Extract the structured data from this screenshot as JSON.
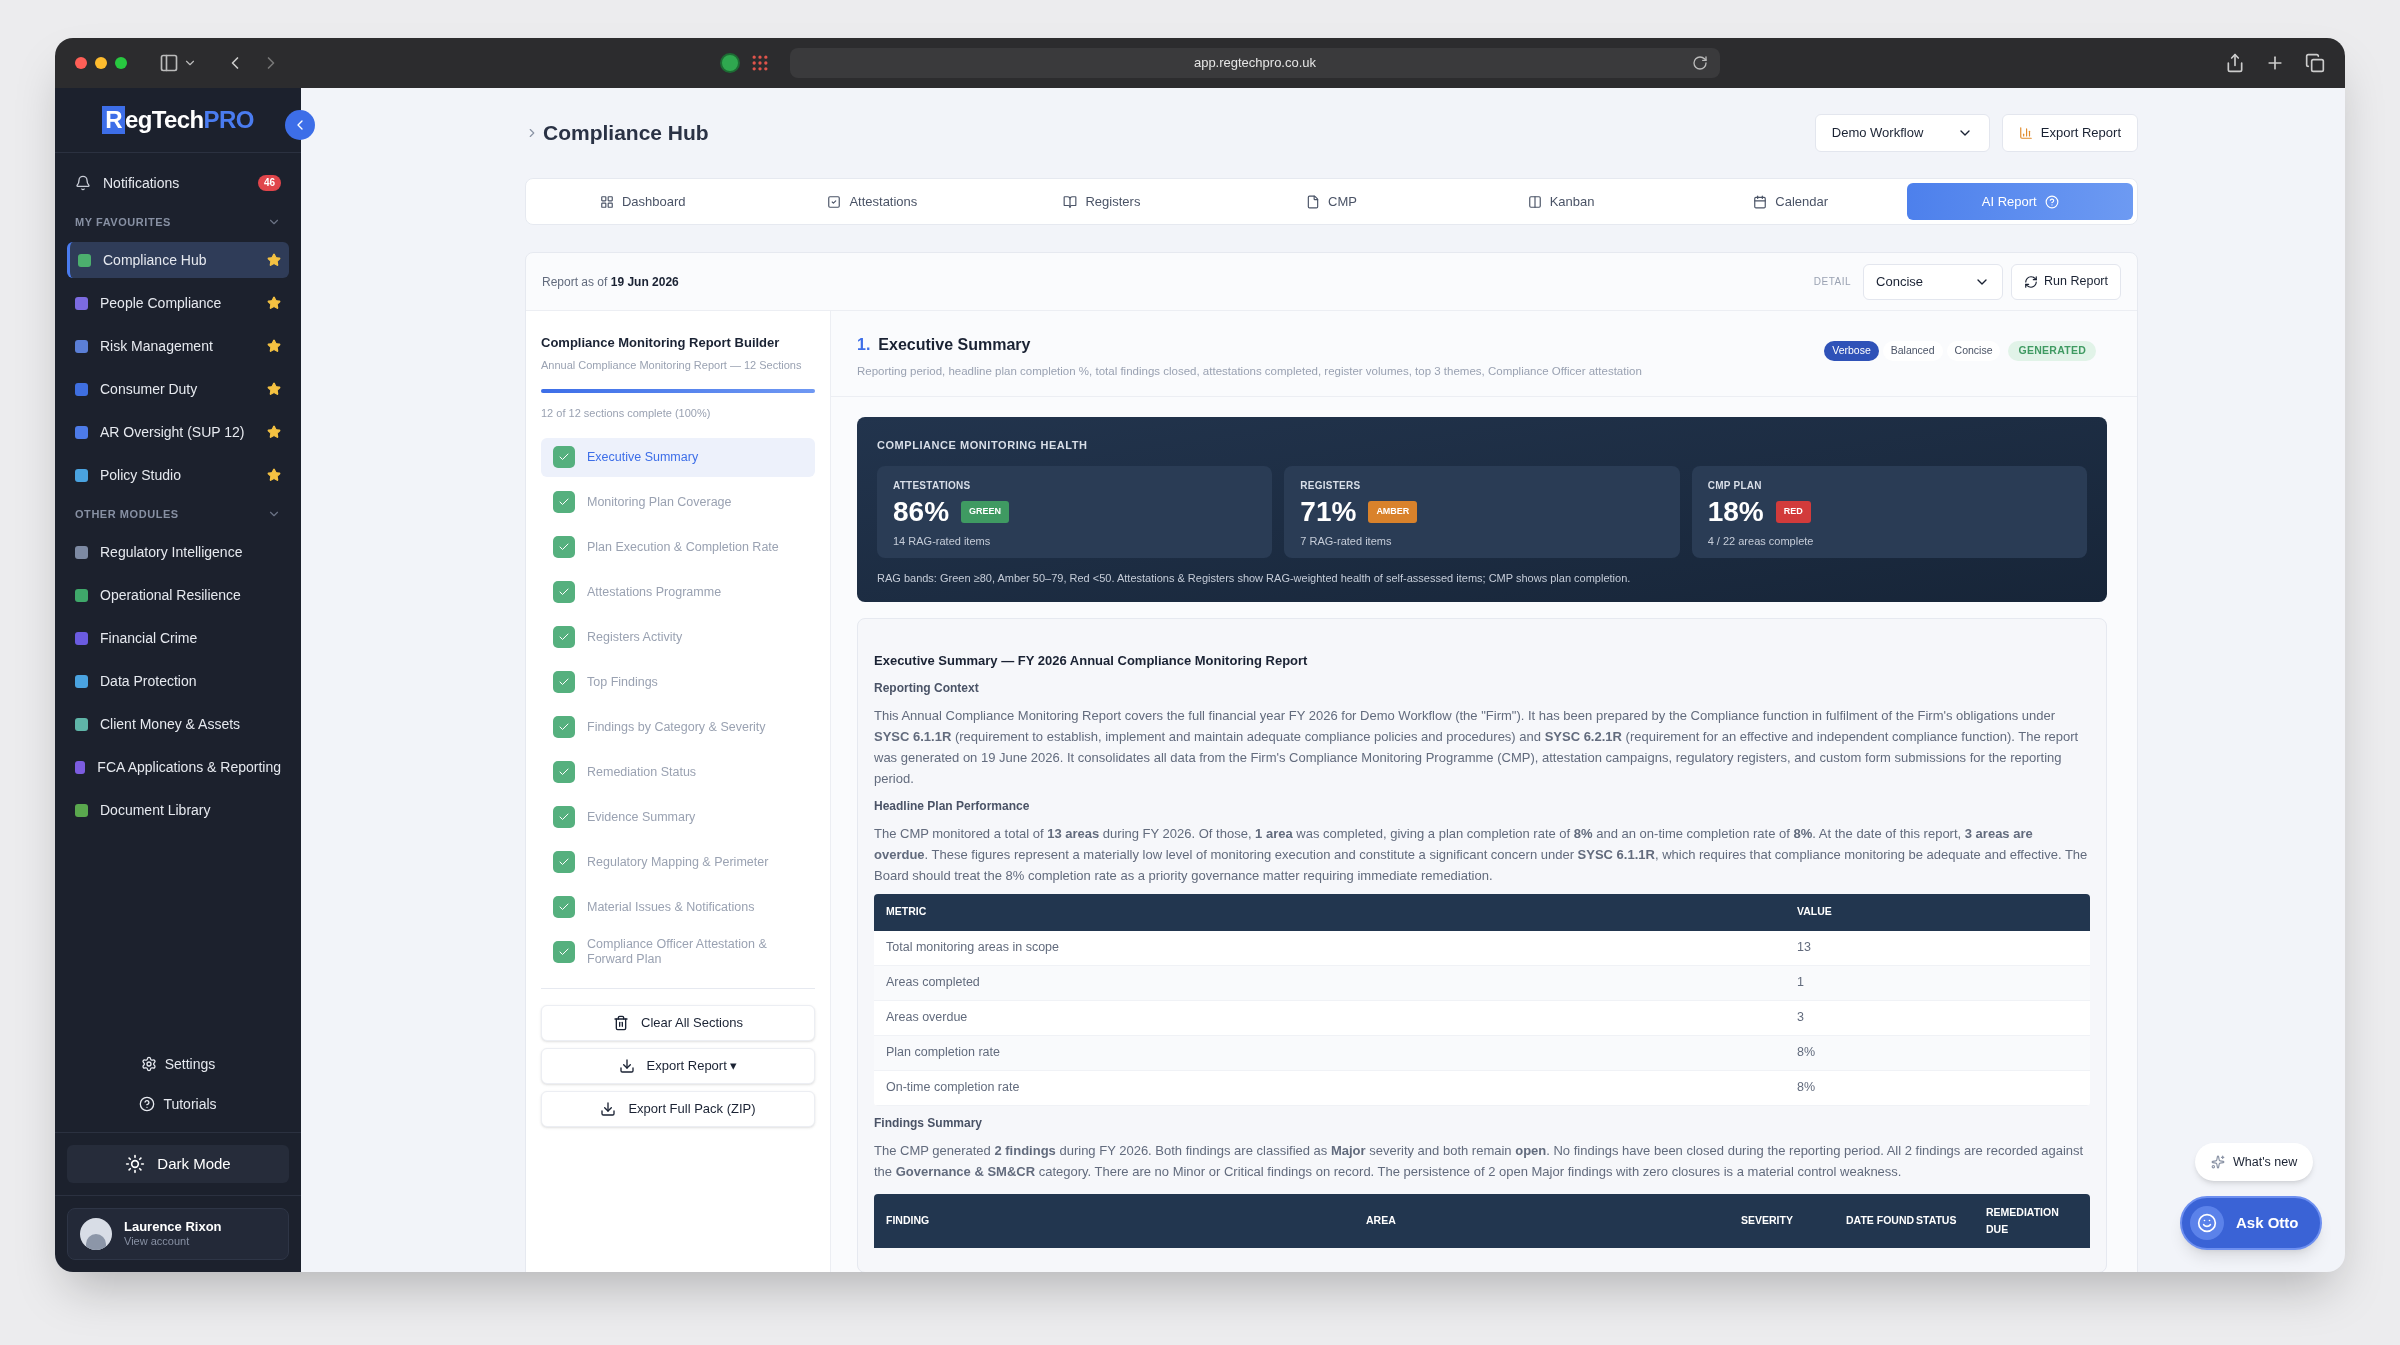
{
  "browser": {
    "url": "app.regtechpro.co.uk"
  },
  "sidebar": {
    "logo": {
      "initial": "R",
      "name": "egTech",
      "suffix": "PRO"
    },
    "notifications": {
      "label": "Notifications",
      "count": "46"
    },
    "groups": [
      {
        "heading": "MY FAVOURITES",
        "items": [
          {
            "label": "Compliance Hub",
            "selected": true,
            "color": "#4caf6e"
          },
          {
            "label": "People Compliance",
            "selected": false,
            "color": "#7c6be0"
          },
          {
            "label": "Risk Management",
            "selected": false,
            "color": "#5b7fd6"
          },
          {
            "label": "Consumer Duty",
            "selected": false,
            "color": "#3f6fe0"
          },
          {
            "label": "AR Oversight (SUP 12)",
            "selected": false,
            "color": "#4d7be8"
          },
          {
            "label": "Policy Studio",
            "selected": false,
            "color": "#4aa3e0"
          }
        ]
      },
      {
        "heading": "OTHER MODULES",
        "items": [
          {
            "label": "Regulatory Intelligence",
            "selected": false,
            "color": "#7d8aa3"
          },
          {
            "label": "Operational Resilience",
            "selected": false,
            "color": "#3fa86a"
          },
          {
            "label": "Financial Crime",
            "selected": false,
            "color": "#6b5be0"
          },
          {
            "label": "Data Protection",
            "selected": false,
            "color": "#4aa3e0"
          },
          {
            "label": "Client Money & Assets",
            "selected": false,
            "color": "#5fb5a8"
          },
          {
            "label": "FCA Applications & Reporting",
            "selected": false,
            "color": "#7c5ce0"
          },
          {
            "label": "Document Library",
            "selected": false,
            "color": "#5aa84e"
          }
        ]
      }
    ],
    "settings": "Settings",
    "tutorials": "Tutorials",
    "dark_mode": "Dark Mode",
    "user": {
      "name": "Laurence Rixon",
      "subtitle": "View account"
    }
  },
  "header": {
    "title": "Compliance Hub",
    "workflow": "Demo Workflow",
    "export": "Export Report"
  },
  "tabs": [
    {
      "label": "Dashboard",
      "selected": false
    },
    {
      "label": "Attestations",
      "selected": false
    },
    {
      "label": "Registers",
      "selected": false
    },
    {
      "label": "CMP",
      "selected": false
    },
    {
      "label": "Kanban",
      "selected": false
    },
    {
      "label": "Calendar",
      "selected": false
    },
    {
      "label": "AI Report",
      "selected": true
    }
  ],
  "report_bar": {
    "label": "Report as of",
    "date": "19 Jun 2026",
    "detail_label": "DETAIL",
    "detail": "Concise",
    "run": "Run Report"
  },
  "builder": {
    "title": "Compliance Monitoring Report Builder",
    "subtitle": "Annual Compliance Monitoring Report — 12 Sections",
    "level": 1,
    "progress": "12 of 12 sections complete (100%)",
    "sections": [
      {
        "label": "Executive Summary",
        "checked": true,
        "selected": true
      },
      {
        "label": "Monitoring Plan Coverage",
        "checked": true,
        "selected": false
      },
      {
        "label": "Plan Execution & Completion Rate",
        "checked": true,
        "selected": false
      },
      {
        "label": "Attestations Programme",
        "checked": true,
        "selected": false
      },
      {
        "label": "Registers Activity",
        "checked": true,
        "selected": false
      },
      {
        "label": "Top Findings",
        "checked": true,
        "selected": false
      },
      {
        "label": "Findings by Category & Severity",
        "checked": true,
        "selected": false
      },
      {
        "label": "Remediation Status",
        "checked": true,
        "selected": false
      },
      {
        "label": "Evidence Summary",
        "checked": true,
        "selected": false
      },
      {
        "label": "Regulatory Mapping & Perimeter",
        "checked": true,
        "selected": false
      },
      {
        "label": "Material Issues & Notifications",
        "checked": true,
        "selected": false
      },
      {
        "label": "Compliance Officer Attestation & Forward Plan",
        "checked": true,
        "selected": false
      }
    ],
    "buttons": [
      {
        "kind": "clear",
        "label": "Clear All Sections"
      },
      {
        "kind": "export",
        "label": "Export Report ▾"
      },
      {
        "kind": "export",
        "label": "Export Full Pack (ZIP)"
      }
    ]
  },
  "section": {
    "number": "1.",
    "title": "Executive Summary",
    "description": "Reporting period, headline plan completion %, total findings closed, attestations completed, register volumes, top 3 themes, Compliance Officer attestation",
    "modes": [
      {
        "label": "Verbose",
        "selected": true
      },
      {
        "label": "Balanced",
        "selected": false
      },
      {
        "label": "Concise",
        "selected": false
      }
    ],
    "status": "GENERATED"
  },
  "health": {
    "title": "COMPLIANCE MONITORING HEALTH",
    "cards": [
      {
        "label": "ATTESTATIONS",
        "value": "86%",
        "badge": "GREEN",
        "color": "#3f9a62",
        "caption": "14 RAG-rated items"
      },
      {
        "label": "REGISTERS",
        "value": "71%",
        "badge": "AMBER",
        "color": "#d9822b",
        "caption": "7 RAG-rated items"
      },
      {
        "label": "CMP PLAN",
        "value": "18%",
        "badge": "RED",
        "color": "#d23b3b",
        "caption": "4 / 22 areas complete"
      }
    ],
    "note": "RAG bands: Green ≥80, Amber 50–79, Red <50. Attestations & Registers show RAG-weighted health of self-assessed items; CMP shows plan completion."
  },
  "report": {
    "title": "Executive Summary — FY 2026 Annual Compliance Monitoring Report",
    "blocks": [
      {
        "kind": "heading",
        "text": "Reporting Context"
      },
      {
        "kind": "paragraph",
        "text": "This Annual Compliance Monitoring Report covers the full financial year FY 2026 for Demo Workflow (the \"Firm\"). It has been prepared by the Compliance function in fulfilment of the Firm's obligations under **SYSC 6.1.1R** (requirement to establish, implement and maintain adequate compliance policies and procedures) and **SYSC 6.2.1R** (requirement for an effective and independent compliance function). The report was generated on 19 June 2026. It consolidates all data from the Firm's Compliance Monitoring Programme (CMP), attestation campaigns, regulatory registers, and custom form submissions for the reporting period."
      },
      {
        "kind": "heading",
        "text": "Headline Plan Performance"
      },
      {
        "kind": "paragraph",
        "text": "The CMP monitored a total of **13 areas** during FY 2026. Of those, **1 area** was completed, giving a plan completion rate of **8%** and an on-time completion rate of **8%**. At the date of this report, **3 areas are overdue**. These figures represent a materially low level of monitoring execution and constitute a significant concern under **SYSC 6.1.1R**, which requires that compliance monitoring be adequate and effective. The Board should treat the 8% completion rate as a priority governance matter requiring immediate remediation."
      },
      {
        "kind": "table",
        "columns": [
          "METRIC",
          "VALUE"
        ],
        "rows": [
          [
            "Total monitoring areas in scope",
            "13"
          ],
          [
            "Areas completed",
            "1"
          ],
          [
            "Areas overdue",
            "3"
          ],
          [
            "Plan completion rate",
            "8%"
          ],
          [
            "On-time completion rate",
            "8%"
          ]
        ]
      },
      {
        "kind": "heading",
        "text": "Findings Summary"
      },
      {
        "kind": "paragraph",
        "text": "The CMP generated **2 findings** during FY 2026. Both findings are classified as **Major** severity and both remain **open**. No findings have been closed during the reporting period. All 2 findings are recorded against the **Governance & SM&CR** category. There are no Minor or Critical findings on record. The persistence of 2 open Major findings with zero closures is a material control weakness."
      },
      {
        "kind": "findings_table",
        "columns": [
          "FINDING",
          "AREA",
          "SEVERITY",
          "DATE FOUND",
          "STATUS",
          "REMEDIATION DUE"
        ]
      }
    ]
  },
  "floating": {
    "whats_new": "What's new",
    "assistant": "Ask Otto"
  }
}
